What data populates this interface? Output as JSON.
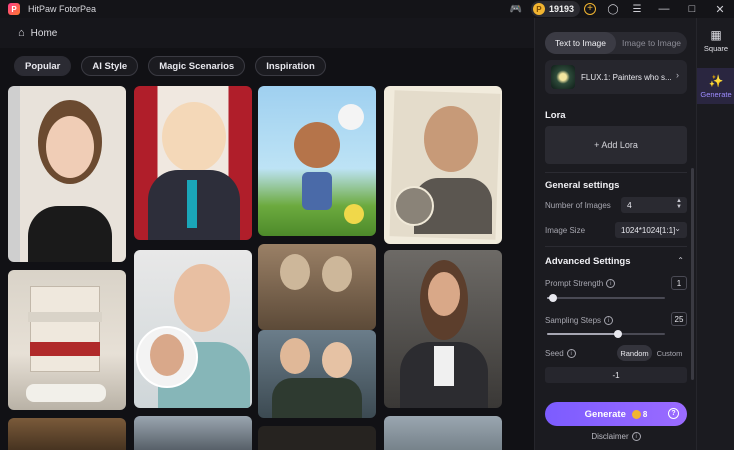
{
  "app": {
    "title": "HitPaw FotorPea"
  },
  "titlebar": {
    "coins": "19193"
  },
  "nav": {
    "home_label": "Home"
  },
  "chips": [
    "Popular",
    "AI Style",
    "Magic Scenarios",
    "Inspiration"
  ],
  "sidenav": {
    "square_label": "Square",
    "generate_label": "Generate"
  },
  "panel": {
    "tabs": [
      "Text to Image",
      "Image to Image"
    ],
    "model_name": "FLUX.1: Painters who s...",
    "lora_heading": "Lora",
    "add_lora_label": "+ Add Lora",
    "general_heading": "General settings",
    "num_images_label": "Number of Images",
    "num_images_value": "4",
    "image_size_label": "Image Size",
    "image_size_value": "1024*1024[1:1]",
    "advanced_heading": "Advanced Settings",
    "prompt_strength_label": "Prompt Strength",
    "prompt_strength_value": "1",
    "prompt_strength_fraction": 0.05,
    "sampling_steps_label": "Sampling Steps",
    "sampling_steps_value": "25",
    "sampling_steps_fraction": 0.6,
    "seed_label": "Seed",
    "seed_random": "Random",
    "seed_custom": "Custom",
    "seed_value": "-1",
    "generate_label": "Generate",
    "generate_cost": "8",
    "disclaimer_label": "Disclaimer"
  },
  "colors": {
    "accent": "#7c5cff",
    "coin": "#f2b531"
  }
}
